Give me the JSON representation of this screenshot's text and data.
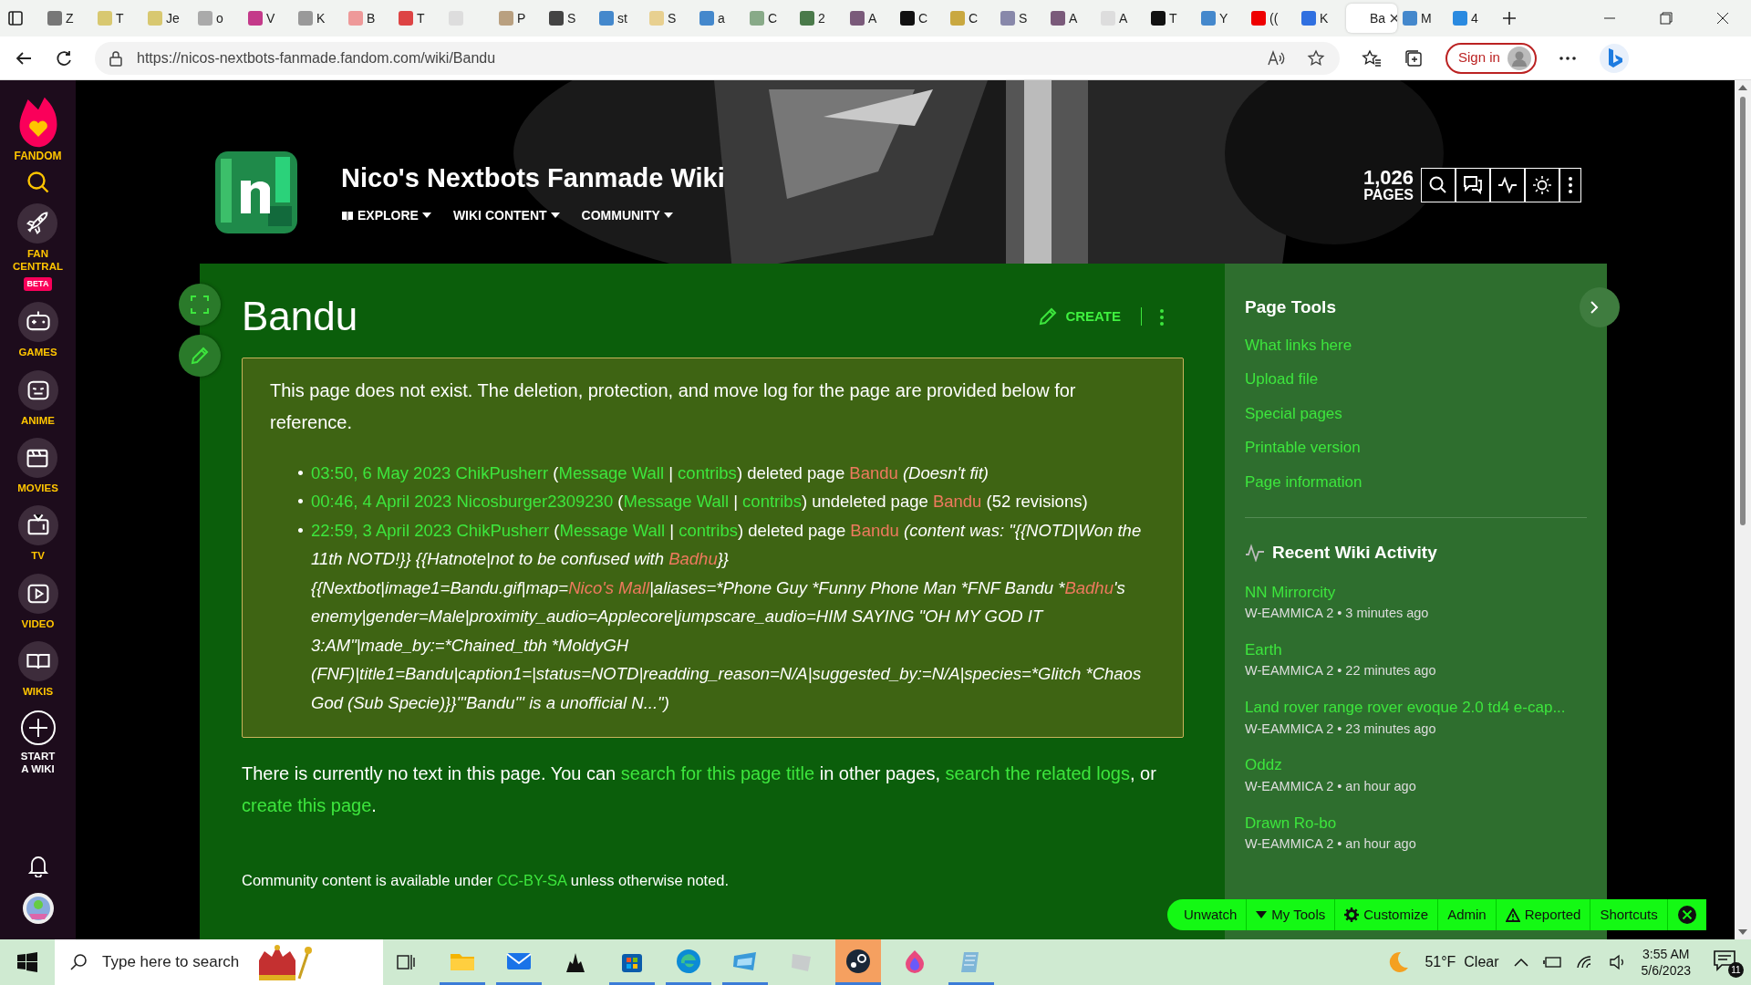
{
  "browser": {
    "tabs": [
      {
        "label": "Z",
        "selected": false
      },
      {
        "label": "T",
        "selected": false
      },
      {
        "label": "Je",
        "selected": false
      },
      {
        "label": "o",
        "selected": false
      },
      {
        "label": "V",
        "selected": false
      },
      {
        "label": "K",
        "selected": false
      },
      {
        "label": "B",
        "selected": false
      },
      {
        "label": "T",
        "selected": false
      },
      {
        "selected": false
      },
      {
        "label": "P",
        "selected": false
      },
      {
        "label": "S",
        "selected": false
      },
      {
        "label": "st",
        "selected": false
      },
      {
        "label": "S",
        "selected": false
      },
      {
        "label": "a",
        "selected": false
      },
      {
        "label": "C",
        "selected": false
      },
      {
        "label": "2",
        "selected": false
      },
      {
        "label": "A",
        "selected": false
      },
      {
        "label": "C",
        "selected": false
      },
      {
        "label": "C",
        "selected": false
      },
      {
        "label": "S",
        "selected": false
      },
      {
        "label": "A",
        "selected": false
      },
      {
        "label": "A",
        "selected": false
      },
      {
        "label": "T",
        "selected": false
      },
      {
        "label": "Y",
        "selected": false
      },
      {
        "label": "((",
        "selected": false
      },
      {
        "label": "K",
        "selected": false
      },
      {
        "label": "Ba",
        "selected": true
      },
      {
        "label": "M",
        "selected": false
      },
      {
        "label": "4",
        "selected": false
      }
    ],
    "url": "https://nicos-nextbots-fanmade.fandom.com/wiki/Bandu",
    "sign_in": "Sign in"
  },
  "fandom_nav": {
    "brand": "FANDOM",
    "items": [
      {
        "label": "FAN CENTRAL",
        "badge": "BETA"
      },
      {
        "label": "GAMES"
      },
      {
        "label": "ANIME"
      },
      {
        "label": "MOVIES"
      },
      {
        "label": "TV"
      },
      {
        "label": "VIDEO"
      },
      {
        "label": "WIKIS"
      },
      {
        "label": "START A WIKI"
      }
    ]
  },
  "wiki": {
    "title": "Nico's Nextbots Fanmade Wiki",
    "nav": [
      "EXPLORE",
      "WIKI CONTENT",
      "COMMUNITY"
    ],
    "page_count": "1,026",
    "page_count_label": "PAGES"
  },
  "page": {
    "title": "Bandu",
    "create": "CREATE",
    "notice": "This page does not exist. The deletion, protection, and move log for the page are provided below for reference.",
    "log": [
      {
        "bullet": "•",
        "parts": [
          {
            "kind": "link",
            "text": "03:50, 6 May 2023"
          },
          {
            "kind": "link",
            "text": "ChikPusherr",
            "space_before": true
          },
          {
            "kind": "text",
            "text": " ("
          },
          {
            "kind": "link",
            "text": "Message Wall"
          },
          {
            "kind": "text",
            "text": " | "
          },
          {
            "kind": "link",
            "text": "contribs"
          },
          {
            "kind": "text",
            "text": ") deleted page "
          },
          {
            "kind": "redlink",
            "text": "Bandu"
          },
          {
            "kind": "comment",
            "text": " (Doesn't fit)"
          }
        ]
      },
      {
        "bullet": "•",
        "parts": [
          {
            "kind": "link",
            "text": "00:46, 4 April 2023"
          },
          {
            "kind": "link",
            "text": "Nicosburger2309230",
            "space_before": true
          },
          {
            "kind": "text",
            "text": " ("
          },
          {
            "kind": "link",
            "text": "Message Wall"
          },
          {
            "kind": "text",
            "text": " | "
          },
          {
            "kind": "link",
            "text": "contribs"
          },
          {
            "kind": "text",
            "text": ") undeleted page "
          },
          {
            "kind": "redlink",
            "text": "Bandu"
          },
          {
            "kind": "text",
            "text": " (52 revisions)"
          }
        ]
      },
      {
        "bullet": "•",
        "parts": [
          {
            "kind": "link",
            "text": "22:59, 3 April 2023"
          },
          {
            "kind": "link",
            "text": "ChikPusherr",
            "space_before": true
          },
          {
            "kind": "text",
            "text": " ("
          },
          {
            "kind": "link",
            "text": "Message Wall"
          },
          {
            "kind": "text",
            "text": " | "
          },
          {
            "kind": "link",
            "text": "contribs"
          },
          {
            "kind": "text",
            "text": ") deleted page "
          },
          {
            "kind": "redlink",
            "text": "Bandu"
          },
          {
            "kind": "comment",
            "text": " (content was: \"{{NOTD|Won the 11th NOTD!}} {{Hatnote|not to be confused with "
          },
          {
            "kind": "comment-redlink",
            "text": "Badhu"
          },
          {
            "kind": "comment",
            "text": "}}{{Nextbot|image1=Bandu.gif|map="
          },
          {
            "kind": "comment-redlink",
            "text": "Nico's Mall"
          },
          {
            "kind": "comment",
            "text": "|aliases=*Phone Guy *Funny Phone Man *FNF Bandu *"
          },
          {
            "kind": "comment-redlink",
            "text": "Badhu"
          },
          {
            "kind": "comment",
            "text": "'s enemy|gender=Male|proximity_audio=Applecore|jumpscare_audio=HIM SAYING \"OH MY GOD IT 3:AM\"|made_by:=*Chained_tbh *MoldyGH (FNF)|title1=Bandu|caption1=|status=NOTD|readding_reason=N/A|suggested_by:=N/A|species=*Glitch *Chaos God (Sub Specie)}}'''Bandu''' is a unofficial N...\")"
          }
        ]
      }
    ],
    "body": [
      {
        "kind": "text",
        "text": "There is currently no text in this page. You can "
      },
      {
        "kind": "link",
        "text": "search for this page title"
      },
      {
        "kind": "text",
        "text": " in other pages, "
      },
      {
        "kind": "link",
        "text": "search the related logs"
      },
      {
        "kind": "text",
        "text": ", or "
      },
      {
        "kind": "link",
        "text": "create this page"
      },
      {
        "kind": "text",
        "text": "."
      }
    ],
    "footer": [
      {
        "kind": "text",
        "text": "Community content is available under "
      },
      {
        "kind": "link",
        "text": "CC-BY-SA"
      },
      {
        "kind": "text",
        "text": " unless otherwise noted."
      }
    ]
  },
  "sidebar": {
    "tools_title": "Page Tools",
    "tools": [
      "What links here",
      "Upload file",
      "Special pages",
      "Printable version",
      "Page information"
    ],
    "activity_title": "Recent Wiki Activity",
    "activity": [
      {
        "page": "NN Mirrorcity",
        "meta": "W-EAMMICA 2 • 3 minutes ago"
      },
      {
        "page": "Earth",
        "meta": "W-EAMMICA 2 • 22 minutes ago"
      },
      {
        "page": "Land rover range rover evoque 2.0 td4 e-cap...",
        "meta": "W-EAMMICA 2 • 23 minutes ago"
      },
      {
        "page": "Oddz",
        "meta": "W-EAMMICA 2 • an hour ago"
      },
      {
        "page": "Drawn Ro-bo",
        "meta": "W-EAMMICA 2 • an hour ago"
      }
    ]
  },
  "toolbar": [
    {
      "kind": "plain",
      "label": "Unwatch"
    },
    {
      "kind": "menu",
      "label": "My Tools"
    },
    {
      "kind": "gear",
      "label": "Customize"
    },
    {
      "kind": "plain",
      "label": "Admin"
    },
    {
      "kind": "warning",
      "label": "Reported"
    },
    {
      "kind": "plain",
      "label": "Shortcuts"
    }
  ],
  "taskbar": {
    "search_placeholder": "Type here to search",
    "weather": "51°F  Clear",
    "time": "3:55 AM",
    "date": "5/6/2023",
    "notifications": "11"
  }
}
